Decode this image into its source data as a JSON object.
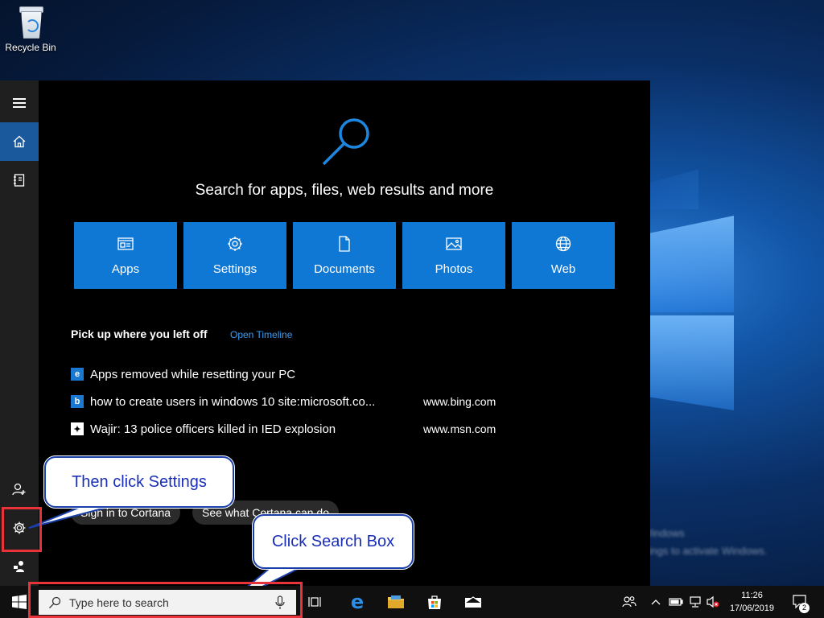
{
  "desktop": {
    "recycle_bin_label": "Recycle Bin",
    "watermark_line1": "Activate Windows",
    "watermark_line2": "Go to Settings to activate Windows."
  },
  "search_panel": {
    "prompt": "Search for apps, files, web results and more",
    "tiles": [
      {
        "label": "Apps",
        "icon": "apps-icon"
      },
      {
        "label": "Settings",
        "icon": "gear-icon"
      },
      {
        "label": "Documents",
        "icon": "document-icon"
      },
      {
        "label": "Photos",
        "icon": "photo-icon"
      },
      {
        "label": "Web",
        "icon": "globe-icon"
      }
    ],
    "recent_heading": "Pick up where you left off",
    "timeline_link": "Open Timeline",
    "recent_items": [
      {
        "title": "Apps removed while resetting your PC",
        "source": "",
        "icon": "edge-icon"
      },
      {
        "title": "how to create users in windows 10 site:microsoft.co...",
        "source": "www.bing.com",
        "icon": "bing-icon"
      },
      {
        "title": "Wajir: 13 police officers killed in IED explosion",
        "source": "www.msn.com",
        "icon": "msn-icon"
      }
    ],
    "cortana_signin": "Sign in to Cortana",
    "cortana_see": "See what Cortana can do"
  },
  "callouts": {
    "settings": "Then click Settings",
    "search": "Click Search Box"
  },
  "taskbar": {
    "search_placeholder": "Type here to search",
    "time": "11:26",
    "date": "17/06/2019",
    "notification_count": "2"
  },
  "colors": {
    "accent": "#0f78d4",
    "highlight": "#e8333a",
    "link": "#3a9ef5"
  }
}
